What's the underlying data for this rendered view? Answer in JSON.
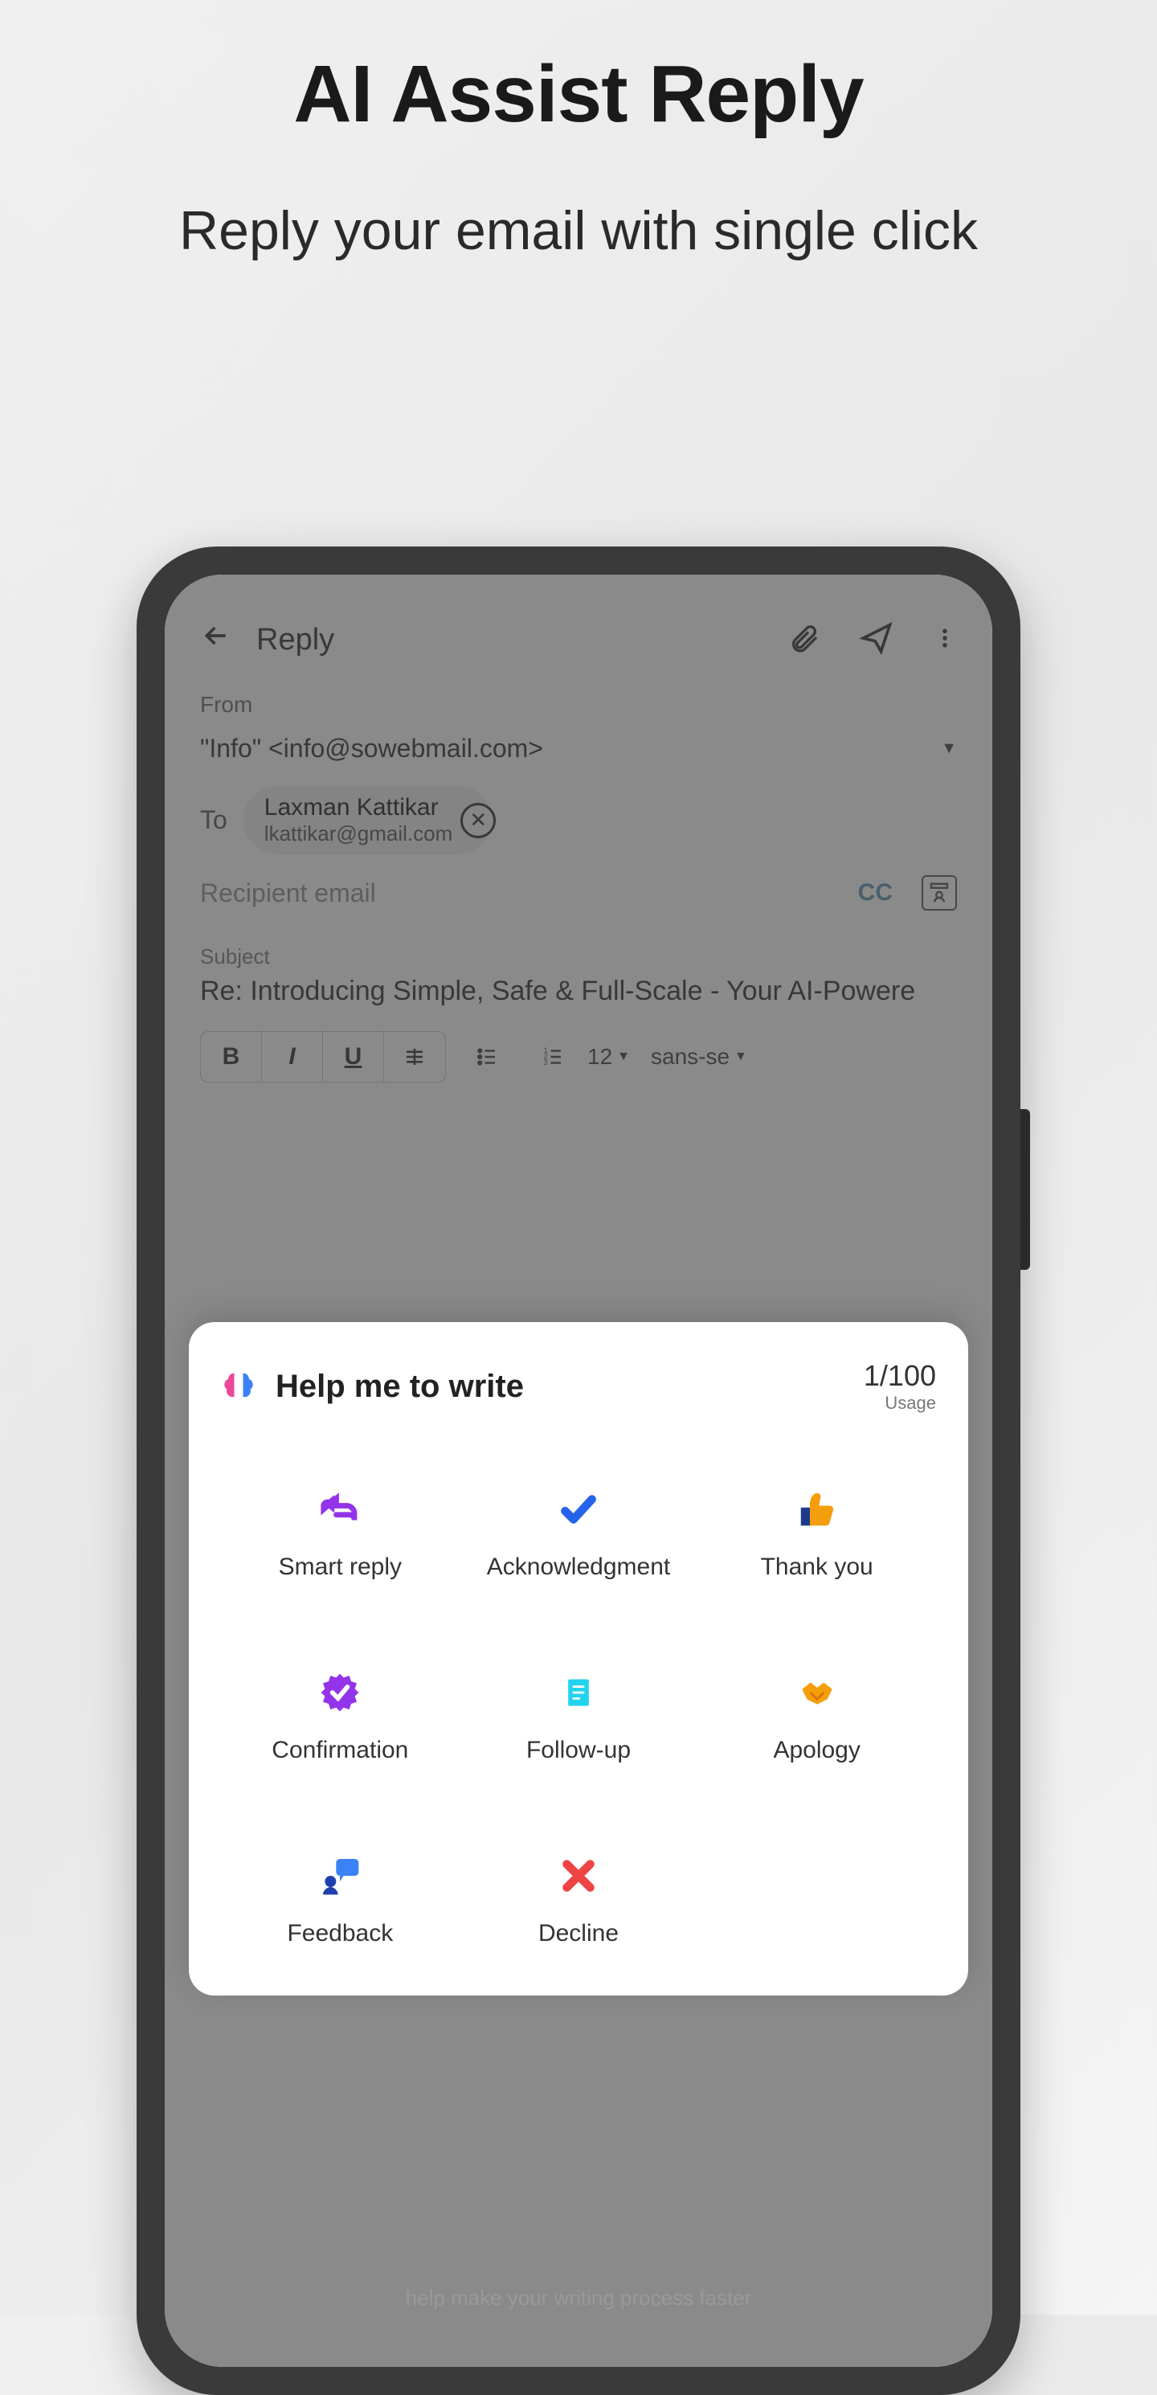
{
  "promo": {
    "title": "AI Assist Reply",
    "subtitle": "Reply your email with single click"
  },
  "email": {
    "header_title": "Reply",
    "from_label": "From",
    "from_value": "\"Info\" <info@sowebmail.com>",
    "to_label": "To",
    "to_chip": {
      "name": "Laxman Kattikar",
      "email": "lkattikar@gmail.com"
    },
    "recipient_placeholder": "Recipient email",
    "cc_label": "CC",
    "subject_label": "Subject",
    "subject_value": "Re: Introducing Simple, Safe & Full-Scale - Your AI-Powere",
    "toolbar": {
      "font_size": "12",
      "font_family": "sans-se"
    }
  },
  "sheet": {
    "title": "Help me to write",
    "usage_count": "1/100",
    "usage_label": "Usage",
    "options": [
      {
        "label": "Smart reply",
        "icon": "reply-arrow",
        "color": "#9333ea"
      },
      {
        "label": "Acknowledgment",
        "icon": "checkmark",
        "color": "#2563eb"
      },
      {
        "label": "Thank you",
        "icon": "thumbs-up",
        "color": "#f59e0b"
      },
      {
        "label": "Confirmation",
        "icon": "badge-check",
        "color": "#9333ea"
      },
      {
        "label": "Follow-up",
        "icon": "document",
        "color": "#22d3ee"
      },
      {
        "label": "Apology",
        "icon": "handshake",
        "color": "#f59e0b"
      },
      {
        "label": "Feedback",
        "icon": "chat-person",
        "color": "#3b82f6"
      },
      {
        "label": "Decline",
        "icon": "x-mark",
        "color": "#ef4444"
      }
    ]
  },
  "footer_hint": "help make your writing process faster"
}
